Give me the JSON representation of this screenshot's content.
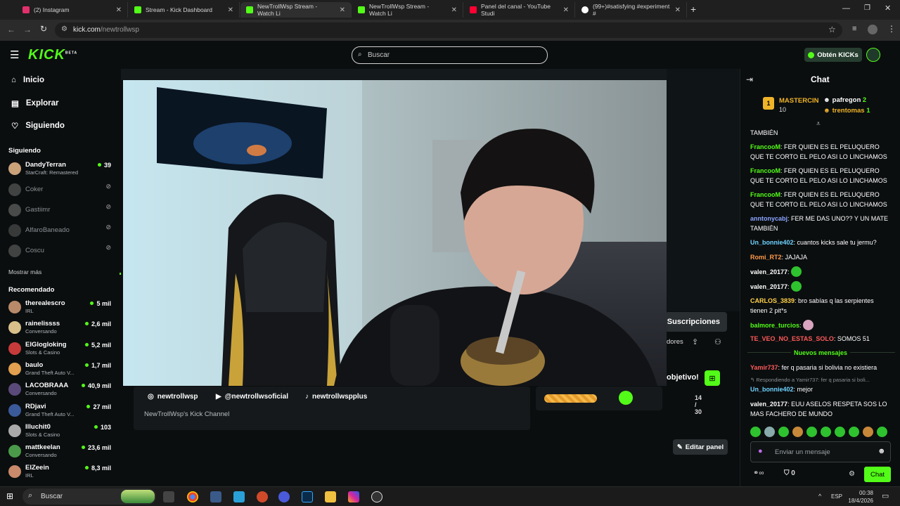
{
  "browser": {
    "tabs": [
      {
        "title": "(2) Instagram",
        "color": "#e1306c"
      },
      {
        "title": "Stream - Kick Dashboard",
        "color": "#53fc18"
      },
      {
        "title": "NewTrollWsp Stream - Watch Li",
        "color": "#53fc18"
      },
      {
        "title": "NewTrollWsp Stream - Watch Li",
        "color": "#53fc18"
      },
      {
        "title": "Panel del canal - YouTube Studi",
        "color": "#ff0033"
      },
      {
        "title": "(99+)#satisfying #experiment #",
        "color": "#ffffff"
      }
    ],
    "url_host": "kick.com",
    "url_path": "/newtrollwsp"
  },
  "header": {
    "logo": "KICK",
    "logo_badge": "BETA",
    "search_placeholder": "Buscar",
    "get_kicks": "Obtén KICKs"
  },
  "sidebar": {
    "nav": [
      {
        "label": "Inicio",
        "icon": "home-icon"
      },
      {
        "label": "Explorar",
        "icon": "compass-icon"
      },
      {
        "label": "Siguiendo",
        "icon": "heart-icon"
      }
    ],
    "following_title": "Siguiendo",
    "following": [
      {
        "name": "DandyTerran",
        "category": "StarCraft: Remastered",
        "viewers": "39",
        "live": true,
        "color": "#c9a27a"
      },
      {
        "name": "Coker",
        "category": "",
        "viewers": "",
        "live": false,
        "color": "#777"
      },
      {
        "name": "Gastiimr",
        "category": "",
        "viewers": "",
        "live": false,
        "color": "#888"
      },
      {
        "name": "AlfaroBaneado",
        "category": "",
        "viewers": "",
        "live": false,
        "color": "#666"
      },
      {
        "name": "Coscu",
        "category": "",
        "viewers": "",
        "live": false,
        "color": "#777"
      }
    ],
    "show_more": "Mostrar más",
    "recommended_title": "Recomendado",
    "recommended": [
      {
        "name": "therealescro",
        "category": "IRL",
        "viewers": "5 mil",
        "color": "#b88a6a"
      },
      {
        "name": "rainelissss",
        "category": "Conversando",
        "viewers": "2,6 mil",
        "color": "#d9c08a"
      },
      {
        "name": "ElGlogloking",
        "category": "Slots & Casino",
        "viewers": "5,2 mil",
        "color": "#c73a3a"
      },
      {
        "name": "baulo",
        "category": "Grand Theft Auto V...",
        "viewers": "1,7 mil",
        "color": "#e0a050"
      },
      {
        "name": "LACOBRAAA",
        "category": "Conversando",
        "viewers": "40,9 mil",
        "color": "#5a4a7a"
      },
      {
        "name": "RDjavi",
        "category": "Grand Theft Auto V...",
        "viewers": "27 mil",
        "color": "#3a5a9a"
      },
      {
        "name": "Illuchit0",
        "category": "Slots & Casino",
        "viewers": "103",
        "color": "#aaa"
      },
      {
        "name": "mattkeelan",
        "category": "Conversando",
        "viewers": "23,6 mil",
        "color": "#4a9a4a"
      },
      {
        "name": "ElZeein",
        "category": "IRL",
        "viewers": "8,3 mil",
        "color": "#c88a6a"
      }
    ]
  },
  "channel": {
    "socials": [
      {
        "label": "newtrollwsp",
        "icon": "instagram-icon"
      },
      {
        "label": "@newtrollwsoficial",
        "icon": "youtube-icon"
      },
      {
        "label": "newtrollwspplus",
        "icon": "tiktok-icon"
      }
    ],
    "description": "NewTrollWsp's Kick Channel",
    "subscriptions_label": "Suscripciones",
    "followers_label": "dores",
    "goal_label": "objetivo!",
    "goal_value": "14",
    "goal_total": "/ 30",
    "goal_progress": 0.47,
    "edit_panel": "Editar panel"
  },
  "chat": {
    "title": "Chat",
    "leaders": [
      {
        "rank": "1",
        "name": "MASTERCIN",
        "count": "10"
      },
      {
        "name": "pafregon",
        "count": "2"
      },
      {
        "name": "trentomas",
        "count": "1"
      }
    ],
    "messages": [
      {
        "user": "",
        "text": "TAMBIÉN",
        "color": "#ffffff"
      },
      {
        "user": "FrancooM",
        "text": "FER QUIEN ES EL PELUQUERO QUE TE CORTO EL PELO ASI LO LINCHAMOS",
        "color": "#53fc18"
      },
      {
        "user": "FrancooM",
        "text": "FER QUIEN ES EL PELUQUERO QUE TE CORTO EL PELO ASI LO LINCHAMOS",
        "color": "#53fc18"
      },
      {
        "user": "FrancooM",
        "text": "FER QUIEN ES EL PELUQUERO QUE TE CORTO EL PELO ASI LO LINCHAMOS",
        "color": "#53fc18"
      },
      {
        "user": "anntonycabj",
        "text": "FER ME DAS UNO?? Y UN MATE TAMBIÉN",
        "color": "#8aa4ff"
      },
      {
        "user": "Un_bonnie402",
        "text": "cuantos kicks sale tu jermu?",
        "color": "#6fd3ff"
      },
      {
        "user": "Romi_RT2",
        "text": "JAJAJA",
        "color": "#ff9a4a"
      },
      {
        "user": "valen_20177",
        "text": "",
        "color": "#ffffff"
      },
      {
        "user": "valen_20177",
        "text": "",
        "color": "#ffffff"
      },
      {
        "user": "CARLOS_3839",
        "text": "bro sabías q las serpientes tienen 2 pit*s",
        "color": "#ffd24a"
      },
      {
        "user": "balmore_turcios",
        "text": "",
        "color": "#53fc18"
      },
      {
        "user": "TE_VEO_NO_ESTAS_SOLO",
        "text": "SOMOS 51",
        "color": "#ff5a5a"
      }
    ],
    "new_messages": "Nuevos mensajes",
    "after": [
      {
        "user": "Yamir737",
        "text": "fer q pasaria si bolivia no existiera",
        "color": "#ff5a5a"
      },
      {
        "reply": "Respondiendo a Yamir737: fer q pasaria si boli..."
      },
      {
        "user": "Un_bonnie402",
        "text": "mejor",
        "color": "#6fd3ff"
      },
      {
        "user": "valen_20177",
        "text": "EUU ASELOS RESPETA SOS LO MAS FACHERO DE MUNDO",
        "color": "#ffffff"
      }
    ],
    "input_placeholder": "Enviar un mensaje",
    "points": "0",
    "send_label": "Chat"
  },
  "taskbar": {
    "search": "Buscar",
    "lang": "ESP",
    "time": "00:38",
    "date": "18/4/2026"
  }
}
